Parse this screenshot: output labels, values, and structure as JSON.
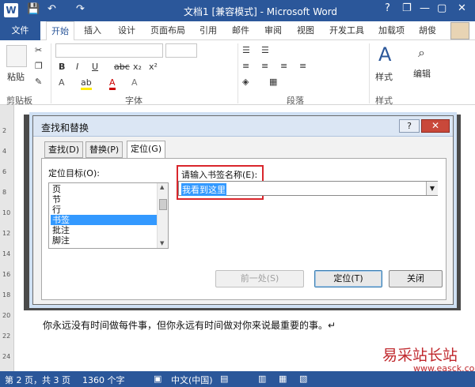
{
  "window": {
    "title": "文档1 [兼容模式] - Microsoft Word",
    "logo": "W",
    "quick_access": {
      "save": "💾",
      "undo": "↶",
      "redo": "↷"
    },
    "controls": {
      "help": "?",
      "restore": "❐",
      "minimize": "—",
      "maximize": "▢",
      "close": "✕"
    }
  },
  "ribbon_tabs": {
    "file": "文件",
    "items": [
      "开始",
      "插入",
      "设计",
      "页面布局",
      "引用",
      "邮件",
      "审阅",
      "视图",
      "开发工具",
      "加载项"
    ],
    "user": "胡俊"
  },
  "ribbon": {
    "clipboard": {
      "paste": "粘贴",
      "label": "剪贴板"
    },
    "font": {
      "label": "字体",
      "bold": "B",
      "italic": "I",
      "underline": "U",
      "strike": "abc",
      "sub": "x₂",
      "sup": "x²",
      "grow": "A",
      "clear": "A"
    },
    "paragraph": {
      "label": "段落"
    },
    "styles": {
      "button": "样式",
      "label": "样式"
    },
    "editing": {
      "button": "编辑"
    }
  },
  "dialog": {
    "title": "查找和替换",
    "help": "?",
    "close": "✕",
    "tabs": [
      "查找(D)",
      "替换(P)",
      "定位(G)"
    ],
    "target_label": "定位目标(O):",
    "targets": [
      "页",
      "节",
      "行",
      "书签",
      "批注",
      "脚注"
    ],
    "selected_target": "书签",
    "bookmark_label": "请输入书签名称(E):",
    "bookmark_value": "我看到这里",
    "buttons": {
      "previous": "前一处(S)",
      "goto": "定位(T)",
      "close": "关闭"
    }
  },
  "document": {
    "ruler_numbers": [
      "2",
      "4",
      "6",
      "8",
      "10",
      "12",
      "14",
      "16",
      "18",
      "20",
      "22",
      "24"
    ],
    "text": "你永远没有时间做每件事，但你永远有时间做对你来说最重要的事。↵"
  },
  "watermark": {
    "text": "易采站长站",
    "url": "www.easck.com"
  },
  "statusbar": {
    "page": "第 2 页，共 3 页",
    "words": "1360 个字",
    "language": "中文(中国)"
  }
}
